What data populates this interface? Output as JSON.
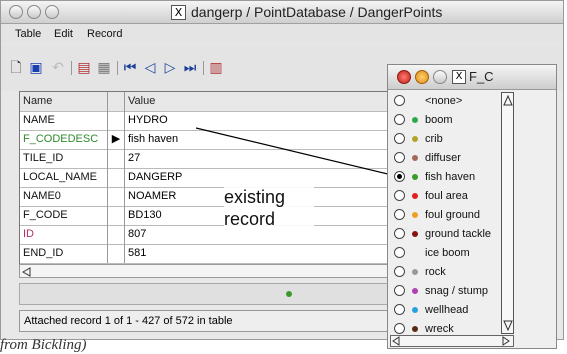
{
  "window": {
    "title_icon": "X",
    "title": "dangerp / PointDatabase / DangerPoints"
  },
  "menu": {
    "items": [
      "Table",
      "Edit",
      "Record"
    ]
  },
  "table": {
    "headers": {
      "name": "Name",
      "value": "Value"
    },
    "rows": [
      {
        "name": "NAME",
        "marker": "",
        "value": "HYDRO",
        "name_color": "#111111"
      },
      {
        "name": "F_CODEDESC",
        "marker": "▶",
        "value": "fish haven",
        "name_color": "#2e8b2e"
      },
      {
        "name": "TILE_ID",
        "marker": "",
        "value": "27",
        "name_color": "#111111"
      },
      {
        "name": "LOCAL_NAME",
        "marker": "",
        "value": "DANGERP",
        "name_color": "#111111"
      },
      {
        "name": "NAME0",
        "marker": "",
        "value": "NOAMER",
        "name_color": "#111111"
      },
      {
        "name": "F_CODE",
        "marker": "",
        "value": "BD130",
        "name_color": "#111111"
      },
      {
        "name": "ID",
        "marker": "",
        "value": "807",
        "name_color": "#b0306a"
      },
      {
        "name": "END_ID",
        "marker": "",
        "value": "581",
        "name_color": "#111111"
      }
    ]
  },
  "status": {
    "dot_color": "#3a9a2a"
  },
  "footer": {
    "text": "Attached record 1 of 1 - 427 of 572 in table"
  },
  "annotation": {
    "line1": "existing",
    "line2": "record"
  },
  "palette": {
    "title_icon": "X",
    "title": "F_C",
    "items": [
      {
        "label": "<none>",
        "color": "",
        "selected": false
      },
      {
        "label": "boom",
        "color": "#2fa84a",
        "selected": false
      },
      {
        "label": "crib",
        "color": "#b5a22a",
        "selected": false
      },
      {
        "label": "diffuser",
        "color": "#a26a5a",
        "selected": false
      },
      {
        "label": "fish haven",
        "color": "#3a9a2a",
        "selected": true
      },
      {
        "label": "foul area",
        "color": "#e02020",
        "selected": false
      },
      {
        "label": "foul ground",
        "color": "#f0a020",
        "selected": false
      },
      {
        "label": "ground tackle",
        "color": "#8a1010",
        "selected": false
      },
      {
        "label": "ice boom",
        "color": "",
        "selected": false
      },
      {
        "label": "rock",
        "color": "#999999",
        "selected": false
      },
      {
        "label": "snag / stump",
        "color": "#b040b0",
        "selected": false
      },
      {
        "label": "wellhead",
        "color": "#2aa0e0",
        "selected": false
      },
      {
        "label": "wreck",
        "color": "#5a2a10",
        "selected": false
      }
    ]
  },
  "caption_fragment": "from Bickling)"
}
